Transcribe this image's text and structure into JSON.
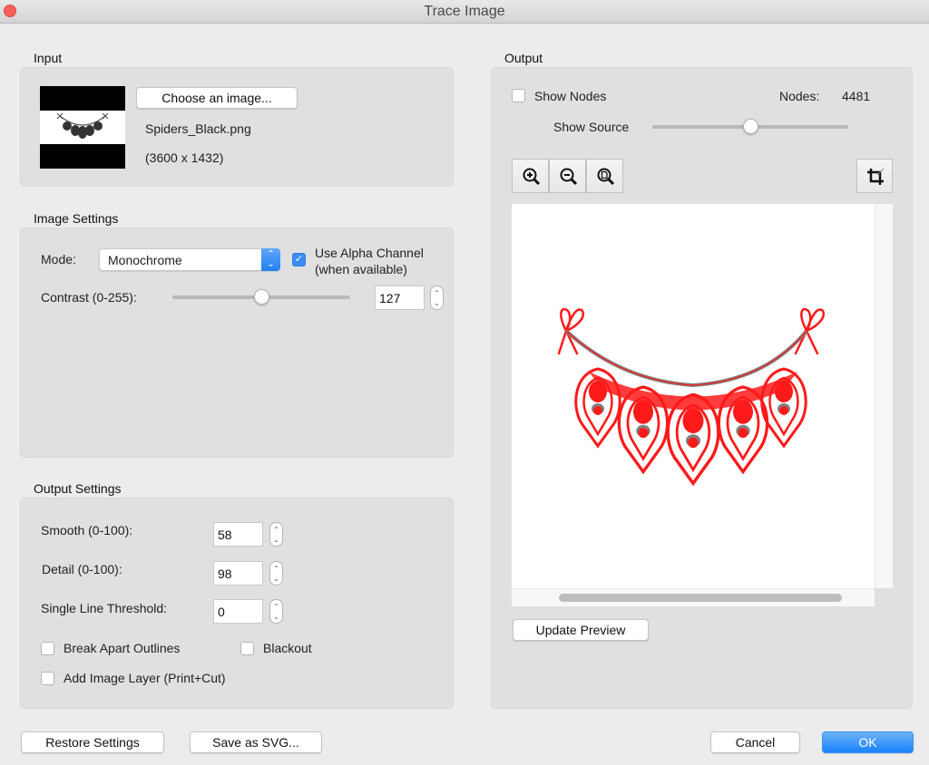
{
  "window": {
    "title": "Trace Image"
  },
  "input": {
    "section_label": "Input",
    "choose_button": "Choose an image...",
    "file_name": "Spiders_Black.png",
    "dimensions": "(3600 x 1432)"
  },
  "image_settings": {
    "section_label": "Image Settings",
    "mode_label": "Mode:",
    "mode_value": "Monochrome",
    "alpha_label_line1": "Use Alpha Channel",
    "alpha_label_line2": "(when available)",
    "alpha_checked": true,
    "contrast_label": "Contrast (0-255):",
    "contrast_value": "127",
    "contrast_fraction": 0.498
  },
  "output_settings": {
    "section_label": "Output Settings",
    "smooth_label": "Smooth (0-100):",
    "smooth_value": "58",
    "detail_label": "Detail (0-100):",
    "detail_value": "98",
    "threshold_label": "Single Line Threshold:",
    "threshold_value": "0",
    "break_apart_label": "Break Apart Outlines",
    "break_apart_checked": false,
    "blackout_label": "Blackout",
    "blackout_checked": false,
    "add_layer_label": "Add Image Layer (Print+Cut)",
    "add_layer_checked": false
  },
  "output": {
    "section_label": "Output",
    "show_nodes_label": "Show Nodes",
    "show_nodes_checked": false,
    "nodes_label": "Nodes:",
    "nodes_value": "4481",
    "show_source_label": "Show Source",
    "show_source_fraction": 0.5,
    "update_preview_button": "Update Preview",
    "trace_color": "#ff1a1a"
  },
  "footer": {
    "restore_button": "Restore Settings",
    "save_svg_button": "Save as SVG...",
    "cancel_button": "Cancel",
    "ok_button": "OK"
  },
  "icons": {
    "stepper_up": "⌃",
    "stepper_down": "⌄",
    "select_arrows": "⇕",
    "check": "✓"
  }
}
